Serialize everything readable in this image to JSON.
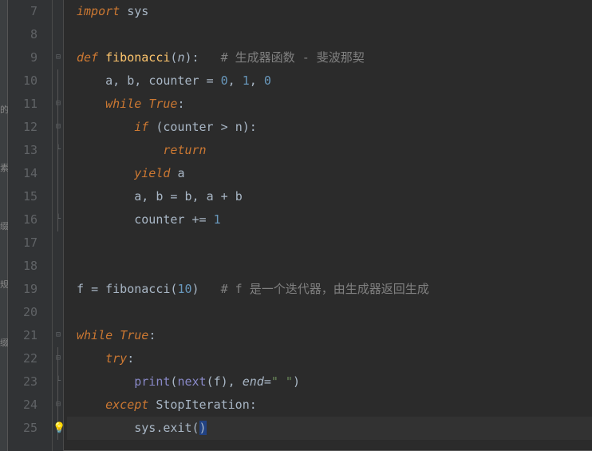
{
  "lines": [
    {
      "num": "7",
      "fold": "",
      "tokens": [
        [
          "kw",
          "import "
        ],
        [
          "ident",
          "sys"
        ]
      ]
    },
    {
      "num": "8",
      "fold": "",
      "tokens": []
    },
    {
      "num": "9",
      "fold": "minus-top",
      "tokens": [
        [
          "kw",
          "def "
        ],
        [
          "fn",
          "fibonacci"
        ],
        [
          "op",
          "("
        ],
        [
          "param",
          "n"
        ],
        [
          "op",
          "):   "
        ],
        [
          "cmt",
          "# 生成器函数 - 斐波那契"
        ]
      ]
    },
    {
      "num": "10",
      "fold": "line",
      "tokens": [
        [
          "txt",
          "    a"
        ],
        [
          "op",
          ", "
        ],
        [
          "txt",
          "b"
        ],
        [
          "op",
          ", "
        ],
        [
          "txt",
          "counter "
        ],
        [
          "op",
          "= "
        ],
        [
          "num",
          "0"
        ],
        [
          "op",
          ", "
        ],
        [
          "num",
          "1"
        ],
        [
          "op",
          ", "
        ],
        [
          "num",
          "0"
        ]
      ]
    },
    {
      "num": "11",
      "fold": "minus",
      "tokens": [
        [
          "txt",
          "    "
        ],
        [
          "kw",
          "while "
        ],
        [
          "kw",
          "True"
        ],
        [
          "op",
          ":"
        ]
      ]
    },
    {
      "num": "12",
      "fold": "minus",
      "tokens": [
        [
          "txt",
          "        "
        ],
        [
          "kw",
          "if "
        ],
        [
          "op",
          "("
        ],
        [
          "txt",
          "counter "
        ],
        [
          "op",
          "> "
        ],
        [
          "txt",
          "n"
        ],
        [
          "op",
          "):"
        ]
      ]
    },
    {
      "num": "13",
      "fold": "end",
      "tokens": [
        [
          "txt",
          "            "
        ],
        [
          "kw",
          "return"
        ]
      ]
    },
    {
      "num": "14",
      "fold": "line",
      "tokens": [
        [
          "txt",
          "        "
        ],
        [
          "kw",
          "yield "
        ],
        [
          "txt",
          "a"
        ]
      ]
    },
    {
      "num": "15",
      "fold": "line",
      "tokens": [
        [
          "txt",
          "        a"
        ],
        [
          "op",
          ", "
        ],
        [
          "txt",
          "b "
        ],
        [
          "op",
          "= "
        ],
        [
          "txt",
          "b"
        ],
        [
          "op",
          ", "
        ],
        [
          "txt",
          "a "
        ],
        [
          "op",
          "+ "
        ],
        [
          "txt",
          "b"
        ]
      ]
    },
    {
      "num": "16",
      "fold": "end",
      "tokens": [
        [
          "txt",
          "        counter "
        ],
        [
          "op",
          "+= "
        ],
        [
          "num",
          "1"
        ]
      ]
    },
    {
      "num": "17",
      "fold": "",
      "tokens": []
    },
    {
      "num": "18",
      "fold": "",
      "tokens": []
    },
    {
      "num": "19",
      "fold": "",
      "tokens": [
        [
          "txt",
          "f "
        ],
        [
          "op",
          "= "
        ],
        [
          "txt",
          "fibonacci("
        ],
        [
          "num",
          "10"
        ],
        [
          "op",
          ")   "
        ],
        [
          "cmt",
          "# f 是一个迭代器，由生成器返回生成"
        ]
      ]
    },
    {
      "num": "20",
      "fold": "",
      "tokens": []
    },
    {
      "num": "21",
      "fold": "minus-top",
      "tokens": [
        [
          "kw",
          "while "
        ],
        [
          "kw",
          "True"
        ],
        [
          "op",
          ":"
        ]
      ]
    },
    {
      "num": "22",
      "fold": "minus",
      "tokens": [
        [
          "txt",
          "    "
        ],
        [
          "kw",
          "try"
        ],
        [
          "op",
          ":"
        ]
      ]
    },
    {
      "num": "23",
      "fold": "end",
      "tokens": [
        [
          "txt",
          "        "
        ],
        [
          "builtin",
          "print"
        ],
        [
          "op",
          "("
        ],
        [
          "builtin",
          "next"
        ],
        [
          "op",
          "("
        ],
        [
          "txt",
          "f"
        ],
        [
          "op",
          ")"
        ],
        [
          "op",
          ", "
        ],
        [
          "param",
          "end"
        ],
        [
          "op",
          "="
        ],
        [
          "str",
          "\" \""
        ],
        [
          "op",
          ")"
        ]
      ]
    },
    {
      "num": "24",
      "fold": "minus",
      "tokens": [
        [
          "txt",
          "    "
        ],
        [
          "kw",
          "except "
        ],
        [
          "txt",
          "StopIteration"
        ],
        [
          "op",
          ":"
        ]
      ]
    },
    {
      "num": "25",
      "fold": "end",
      "tokens": [
        [
          "txt",
          "        sys."
        ],
        [
          "txt",
          "exit"
        ],
        [
          "op",
          "("
        ],
        [
          "cursor",
          ")"
        ]
      ],
      "highlight": true,
      "bulb": true
    }
  ],
  "leftStrip": [
    "的",
    "素",
    "缀",
    "规",
    "缀"
  ]
}
